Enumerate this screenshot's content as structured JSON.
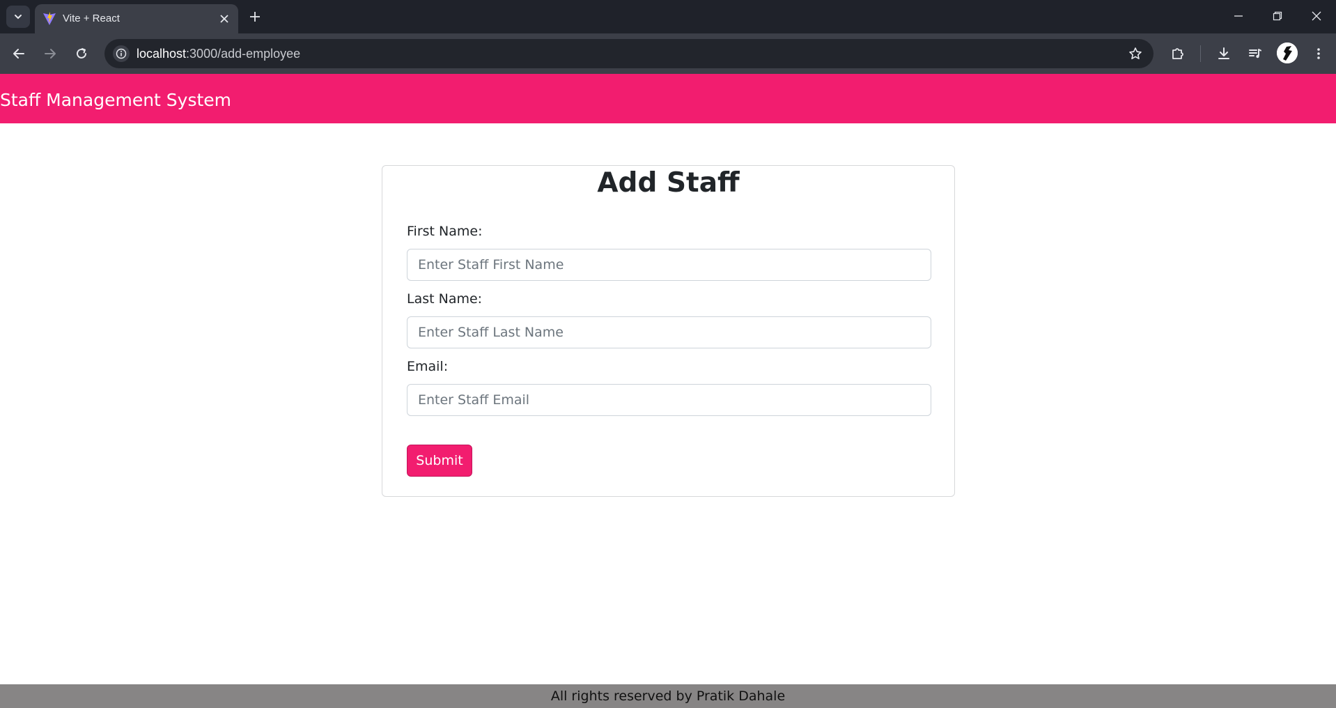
{
  "browser": {
    "tab_title": "Vite + React",
    "url_host": "localhost",
    "url_rest": ":3000/add-employee",
    "icons": {
      "tab_search": "chevron-down-icon",
      "favicon": "vite-logo-icon",
      "tab_close": "close-icon",
      "new_tab": "plus-icon",
      "back": "arrow-left-icon",
      "forward": "arrow-right-icon",
      "reload": "reload-icon",
      "site_info": "info-icon",
      "bookmark": "star-icon",
      "extensions": "puzzle-icon",
      "downloads": "download-icon",
      "media": "media-queue-icon",
      "menu": "kebab-menu-icon"
    }
  },
  "app": {
    "brand": "Staff Management System",
    "accent_color": "#f21d6f",
    "form": {
      "title": "Add Staff",
      "first_name_label": "First Name:",
      "first_name_placeholder": "Enter Staff First Name",
      "first_name_value": "",
      "last_name_label": "Last Name:",
      "last_name_placeholder": "Enter Staff Last Name",
      "last_name_value": "",
      "email_label": "Email:",
      "email_placeholder": "Enter Staff Email",
      "email_value": "",
      "submit_label": "Submit"
    },
    "footer_text": "All rights reserved by Pratik Dahale",
    "footer_color": "#878585"
  }
}
